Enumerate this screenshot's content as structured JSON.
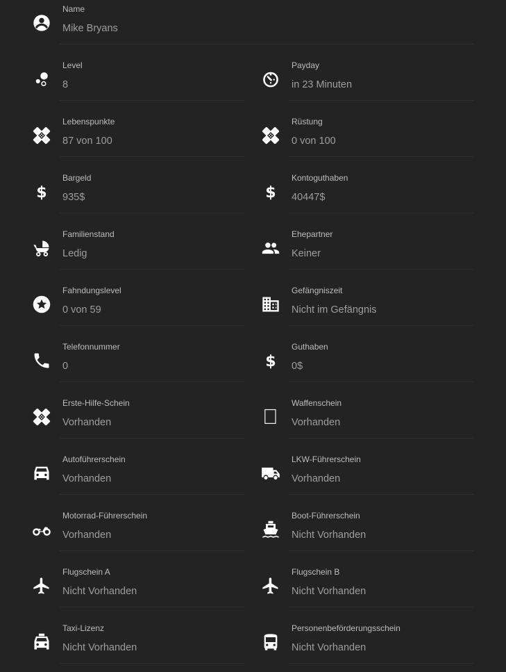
{
  "name": {
    "label": "Name",
    "value": "Mike Bryans",
    "icon": "account-circle-icon"
  },
  "rows": [
    [
      {
        "label": "Level",
        "value": "8",
        "icon": "bubbles-icon"
      },
      {
        "label": "Payday",
        "value": "in 23 Minuten",
        "icon": "timer-icon"
      }
    ],
    [
      {
        "label": "Lebenspunkte",
        "value": "87 von 100",
        "icon": "bandage-icon"
      },
      {
        "label": "Rüstung",
        "value": "0 von 100",
        "icon": "bandage-icon"
      }
    ],
    [
      {
        "label": "Bargeld",
        "value": "935$",
        "icon": "dollar-icon"
      },
      {
        "label": "Kontoguthaben",
        "value": "40447$",
        "icon": "dollar-icon"
      }
    ],
    [
      {
        "label": "Familienstand",
        "value": "Ledig",
        "icon": "stroller-icon"
      },
      {
        "label": "Ehepartner",
        "value": "Keiner",
        "icon": "people-icon"
      }
    ],
    [
      {
        "label": "Fahndungslevel",
        "value": "0 von 59",
        "icon": "star-circle-icon"
      },
      {
        "label": "Gefängniszeit",
        "value": "Nicht im Gefängnis",
        "icon": "building-icon"
      }
    ],
    [
      {
        "label": "Telefonnummer",
        "value": "0",
        "icon": "phone-icon"
      },
      {
        "label": "Guthaben",
        "value": "0$",
        "icon": "dollar-icon"
      }
    ],
    [
      {
        "label": "Erste-Hilfe-Schein",
        "value": "Vorhanden",
        "icon": "bandage-icon"
      },
      {
        "label": "Waffenschein",
        "value": "Vorhanden",
        "icon": "missing-glyph-icon"
      }
    ],
    [
      {
        "label": "Autoführerschein",
        "value": "Vorhanden",
        "icon": "car-icon"
      },
      {
        "label": "LKW-Führerschein",
        "value": "Vorhanden",
        "icon": "truck-icon"
      }
    ],
    [
      {
        "label": "Motorrad-Führerschein",
        "value": "Vorhanden",
        "icon": "motorbike-icon"
      },
      {
        "label": "Boot-Führerschein",
        "value": "Nicht Vorhanden",
        "icon": "ship-icon"
      }
    ],
    [
      {
        "label": "Flugschein A",
        "value": "Nicht Vorhanden",
        "icon": "airplane-icon"
      },
      {
        "label": "Flugschein B",
        "value": "Nicht Vorhanden",
        "icon": "airplane-icon"
      }
    ],
    [
      {
        "label": "Taxi-Lizenz",
        "value": "Nicht Vorhanden",
        "icon": "taxi-icon"
      },
      {
        "label": "Personenbeförderungsschein",
        "value": "Nicht Vorhanden",
        "icon": "bus-icon"
      }
    ]
  ]
}
